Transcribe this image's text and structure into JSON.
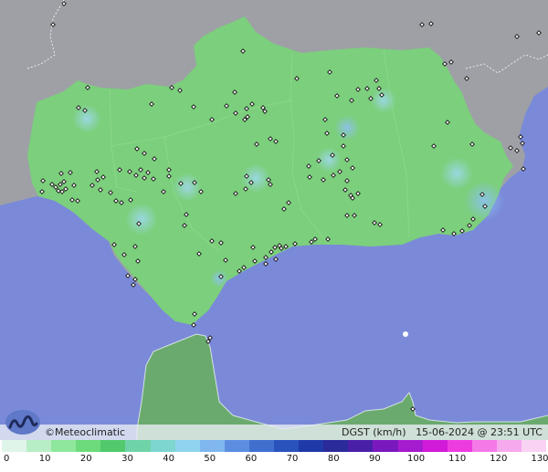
{
  "legend": {
    "brand": "©Meteoclimatic",
    "variable": "DGST (km/h)",
    "datetime": "15-06-2024 @ 23:51 UTC",
    "ticks": [
      "0",
      "10",
      "20",
      "30",
      "40",
      "50",
      "60",
      "70",
      "80",
      "90",
      "100",
      "110",
      "120",
      "130"
    ]
  },
  "colors": {
    "sea": "#7a8ad8",
    "land_outside": "#9ea0a6",
    "region_green": "#7ccf7c",
    "morocco_green": "#6aaa6e",
    "station_marker": "#111111",
    "logo_bg": "#5f78c8",
    "scale": [
      "#dff5ea",
      "#b8eec5",
      "#8ee89c",
      "#6cdb7b",
      "#52c96c",
      "#6fd3a8",
      "#7dd6cf",
      "#8fd3f0",
      "#7fb7ee",
      "#5b8ee0",
      "#3f6fcf",
      "#2a52bd",
      "#1f3aa8",
      "#2a2a9a",
      "#4a1fa8",
      "#7a18c0",
      "#a51bd0",
      "#d21bd8",
      "#ee3be0",
      "#f57ae8",
      "#f7a9ee",
      "#f9d2f4"
    ]
  },
  "icons": {
    "logo": "meteoclimatic-logo-icon",
    "station": "station-marker-icon"
  }
}
